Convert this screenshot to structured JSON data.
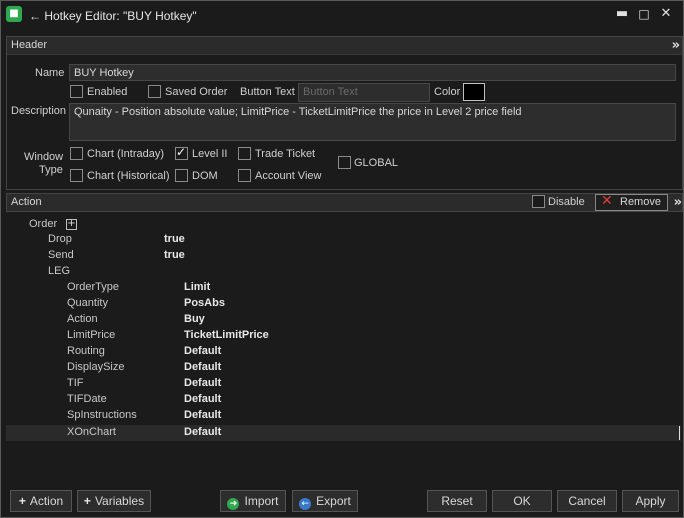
{
  "window": {
    "title": "← Hotkey Editor: \"BUY  Hotkey\"",
    "icon": "app-logo-icon",
    "controls": [
      "minimize-icon",
      "maximize-icon",
      "close-icon"
    ]
  },
  "header": {
    "section_label": "Header",
    "name_label": "Name",
    "name_value": "BUY  Hotkey",
    "enabled_label": "Enabled",
    "enabled_checked": false,
    "saved_order_label": "Saved Order",
    "saved_order_checked": false,
    "button_text_label": "Button Text",
    "button_text_placeholder": "Button Text",
    "color_label": "Color",
    "color_value": "#000000",
    "description_label": "Description",
    "description_value": "Qunaity - Position absolute value; LimitPrice - TicketLimitPrice the price in Level 2 price field",
    "window_type_label_1": "Window",
    "window_type_label_2": "Type",
    "window_types": [
      {
        "label": "Chart (Intraday)",
        "checked": false
      },
      {
        "label": "Level II",
        "checked": true
      },
      {
        "label": "Trade Ticket",
        "checked": false
      },
      {
        "label": "Chart (Historical)",
        "checked": false
      },
      {
        "label": "DOM",
        "checked": false
      },
      {
        "label": "Account View",
        "checked": false
      }
    ],
    "global_label": "GLOBAL",
    "global_checked": false
  },
  "action": {
    "section_label": "Action",
    "disable_label": "Disable",
    "disable_checked": false,
    "remove_label": "Remove"
  },
  "tree": {
    "root_label": "Order",
    "order_children": [
      {
        "key": "Drop",
        "value": "true"
      },
      {
        "key": "Send",
        "value": "true"
      }
    ],
    "leg_label": "LEG",
    "leg_children": [
      {
        "key": "OrderType",
        "value": "Limit"
      },
      {
        "key": "Quantity",
        "value": "PosAbs"
      },
      {
        "key": "Action",
        "value": "Buy"
      },
      {
        "key": "LimitPrice",
        "value": "TicketLimitPrice"
      },
      {
        "key": "Routing",
        "value": "Default"
      },
      {
        "key": "DisplaySize",
        "value": "Default"
      },
      {
        "key": "TIF",
        "value": "Default"
      },
      {
        "key": "TIFDate",
        "value": "Default"
      },
      {
        "key": "SpInstructions",
        "value": "Default"
      },
      {
        "key": "XOnChart",
        "value": "Default"
      }
    ]
  },
  "footer": {
    "add_action_label": "Action",
    "add_variables_label": "Variables",
    "import_label": "Import",
    "export_label": "Export",
    "reset_label": "Reset",
    "ok_label": "OK",
    "cancel_label": "Cancel",
    "apply_label": "Apply"
  },
  "colors": {
    "background": "#1b1b1b",
    "accent_green": "#2fa84f",
    "remove_red": "#d9413a",
    "selected_row": "#2a2a2a"
  }
}
